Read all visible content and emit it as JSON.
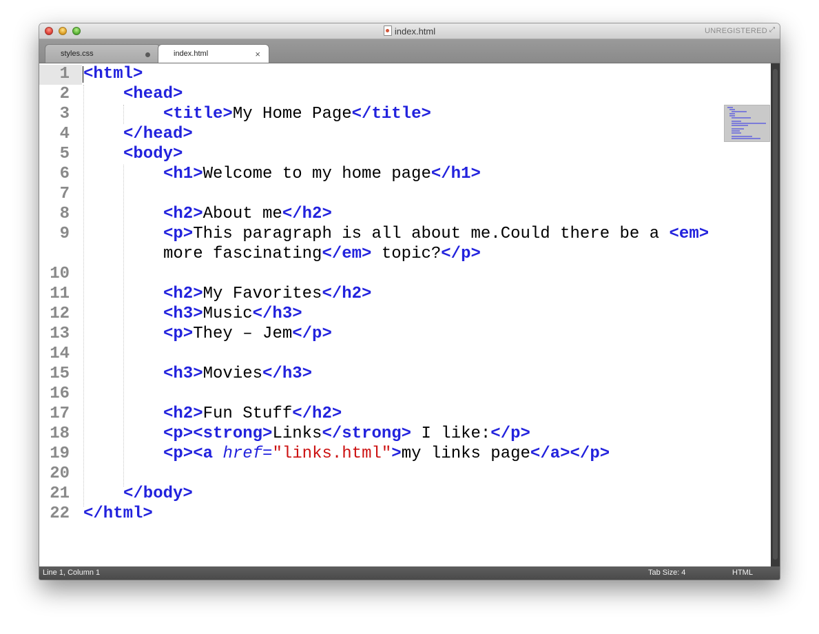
{
  "window": {
    "title": "index.html",
    "registration": "UNREGISTERED"
  },
  "tabs": [
    {
      "label": "styles.css",
      "active": false,
      "modified": true
    },
    {
      "label": "index.html",
      "active": true,
      "modified": false
    }
  ],
  "editor": {
    "line_numbers": [
      "1",
      "2",
      "3",
      "4",
      "5",
      "6",
      "7",
      "8",
      "9",
      "",
      "10",
      "11",
      "12",
      "13",
      "14",
      "15",
      "16",
      "17",
      "18",
      "19",
      "20",
      "21",
      "22"
    ],
    "tokens": {
      "l1": [
        "<html>"
      ],
      "l2": [
        "<head>"
      ],
      "l3": [
        "<title>",
        "My Home Page",
        "</title>"
      ],
      "l4": [
        "</head>"
      ],
      "l5": [
        "<body>"
      ],
      "l6": [
        "<h1>",
        "Welcome to my home page",
        "</h1>"
      ],
      "l8": [
        "<h2>",
        "About me",
        "</h2>"
      ],
      "l9a": [
        "<p>",
        "This paragraph is all about me.Could there be a ",
        "<em>"
      ],
      "l9b": [
        "more fascinating",
        "</em>",
        " topic?",
        "</p>"
      ],
      "l11": [
        "<h2>",
        "My Favorites",
        "</h2>"
      ],
      "l12": [
        "<h3>",
        "Music",
        "</h3>"
      ],
      "l13": [
        "<p>",
        "They – Jem",
        "</p>"
      ],
      "l15": [
        "<h3>",
        "Movies",
        "</h3>"
      ],
      "l17": [
        "<h2>",
        "Fun Stuff",
        "</h2>"
      ],
      "l18": [
        "<p>",
        "<strong>",
        "Links",
        "</strong>",
        " I like:",
        "</p>"
      ],
      "l19": [
        "<p>",
        "<a ",
        "href",
        "=",
        "\"links.html\"",
        ">",
        "my links page",
        "</a>",
        "</p>"
      ],
      "l21": [
        "</body>"
      ],
      "l22": [
        "</html>"
      ]
    },
    "syntax_colors": {
      "tag": "#2222dd",
      "string": "#cc1111",
      "text": "#000000"
    }
  },
  "status": {
    "position": "Line 1, Column 1",
    "tab_size": "Tab Size: 4",
    "syntax": "HTML"
  }
}
